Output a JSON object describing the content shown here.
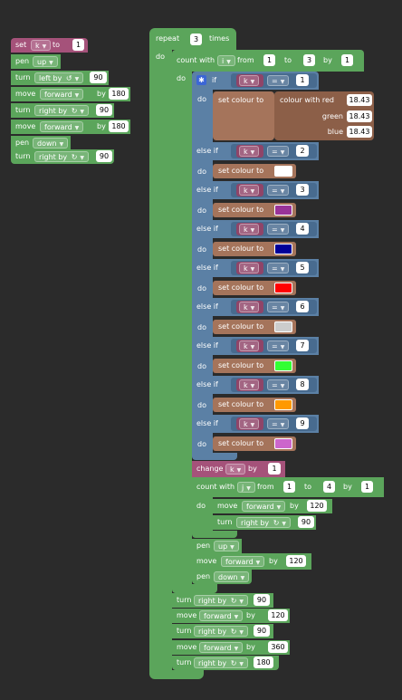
{
  "left_stack": {
    "set_label": "set",
    "set_var": "k",
    "set_to": "to",
    "set_val": "1",
    "pen1_label": "pen",
    "pen1_val": "up",
    "turn1_label": "turn",
    "turn1_dir": "left by",
    "turn1_icon": "↺",
    "turn1_val": "90",
    "move1_label": "move",
    "move1_dir": "forward",
    "move1_by": "by",
    "move1_val": "180",
    "turn2_label": "turn",
    "turn2_dir": "right by",
    "turn2_icon": "↻",
    "turn2_val": "90",
    "move2_label": "move",
    "move2_dir": "forward",
    "move2_by": "by",
    "move2_val": "180",
    "pen2_label": "pen",
    "pen2_val": "down",
    "turn3_label": "turn",
    "turn3_dir": "right by",
    "turn3_icon": "↻",
    "turn3_val": "90"
  },
  "repeat": {
    "label": "repeat",
    "count": "3",
    "times": "times",
    "do": "do"
  },
  "count_i": {
    "label": "count with",
    "var": "i",
    "from": "from",
    "from_val": "1",
    "to": "to",
    "to_val": "3",
    "by": "by",
    "by_val": "1",
    "do": "do"
  },
  "if_block": {
    "if_label": "if",
    "do_label": "do",
    "else_if_label": "else if",
    "var": "k",
    "op": "=",
    "set_colour": "set colour to",
    "colour_with": "colour with red",
    "green": "green",
    "blue": "blue",
    "red_val": "18.43",
    "green_val": "18.43",
    "blue_val": "18.43",
    "branches": [
      {
        "cmp": "1"
      },
      {
        "cmp": "2",
        "color": "#ffffff"
      },
      {
        "cmp": "3",
        "color": "#993399"
      },
      {
        "cmp": "4",
        "color": "#000099"
      },
      {
        "cmp": "5",
        "color": "#ff0000"
      },
      {
        "cmp": "6",
        "color": "#cccccc"
      },
      {
        "cmp": "7",
        "color": "#33ff33"
      },
      {
        "cmp": "8",
        "color": "#ff9900"
      },
      {
        "cmp": "9",
        "color": "#cc66cc"
      }
    ]
  },
  "change": {
    "label": "change",
    "var": "k",
    "by": "by",
    "val": "1"
  },
  "count_j": {
    "label": "count with",
    "var": "j",
    "from": "from",
    "from_val": "1",
    "to": "to",
    "to_val": "4",
    "by": "by",
    "by_val": "1",
    "do": "do"
  },
  "inner": {
    "move_label": "move",
    "move_dir": "forward",
    "move_by": "by",
    "move_val": "120",
    "turn_label": "turn",
    "turn_dir": "right by",
    "turn_icon": "↻",
    "turn_val": "90"
  },
  "after_j": {
    "pen1_label": "pen",
    "pen1_val": "up",
    "move_label": "move",
    "move_dir": "forward",
    "move_by": "by",
    "move_val": "120",
    "pen2_label": "pen",
    "pen2_val": "down"
  },
  "tail": {
    "turn1_label": "turn",
    "turn1_dir": "right by",
    "turn1_icon": "↻",
    "turn1_val": "90",
    "move1_label": "move",
    "move1_dir": "forward",
    "move1_by": "by",
    "move1_val": "120",
    "turn2_label": "turn",
    "turn2_dir": "right by",
    "turn2_icon": "↻",
    "turn2_val": "90",
    "move2_label": "move",
    "move2_dir": "forward",
    "move2_by": "by",
    "move2_val": "360",
    "turn3_label": "turn",
    "turn3_dir": "right by",
    "turn3_icon": "↻",
    "turn3_val": "180"
  },
  "colors": {
    "background": "#2b2b2b",
    "loops": "#5ba55b",
    "variables": "#a5527a",
    "logic": "#5b80a5",
    "colour": "#a5745b"
  }
}
